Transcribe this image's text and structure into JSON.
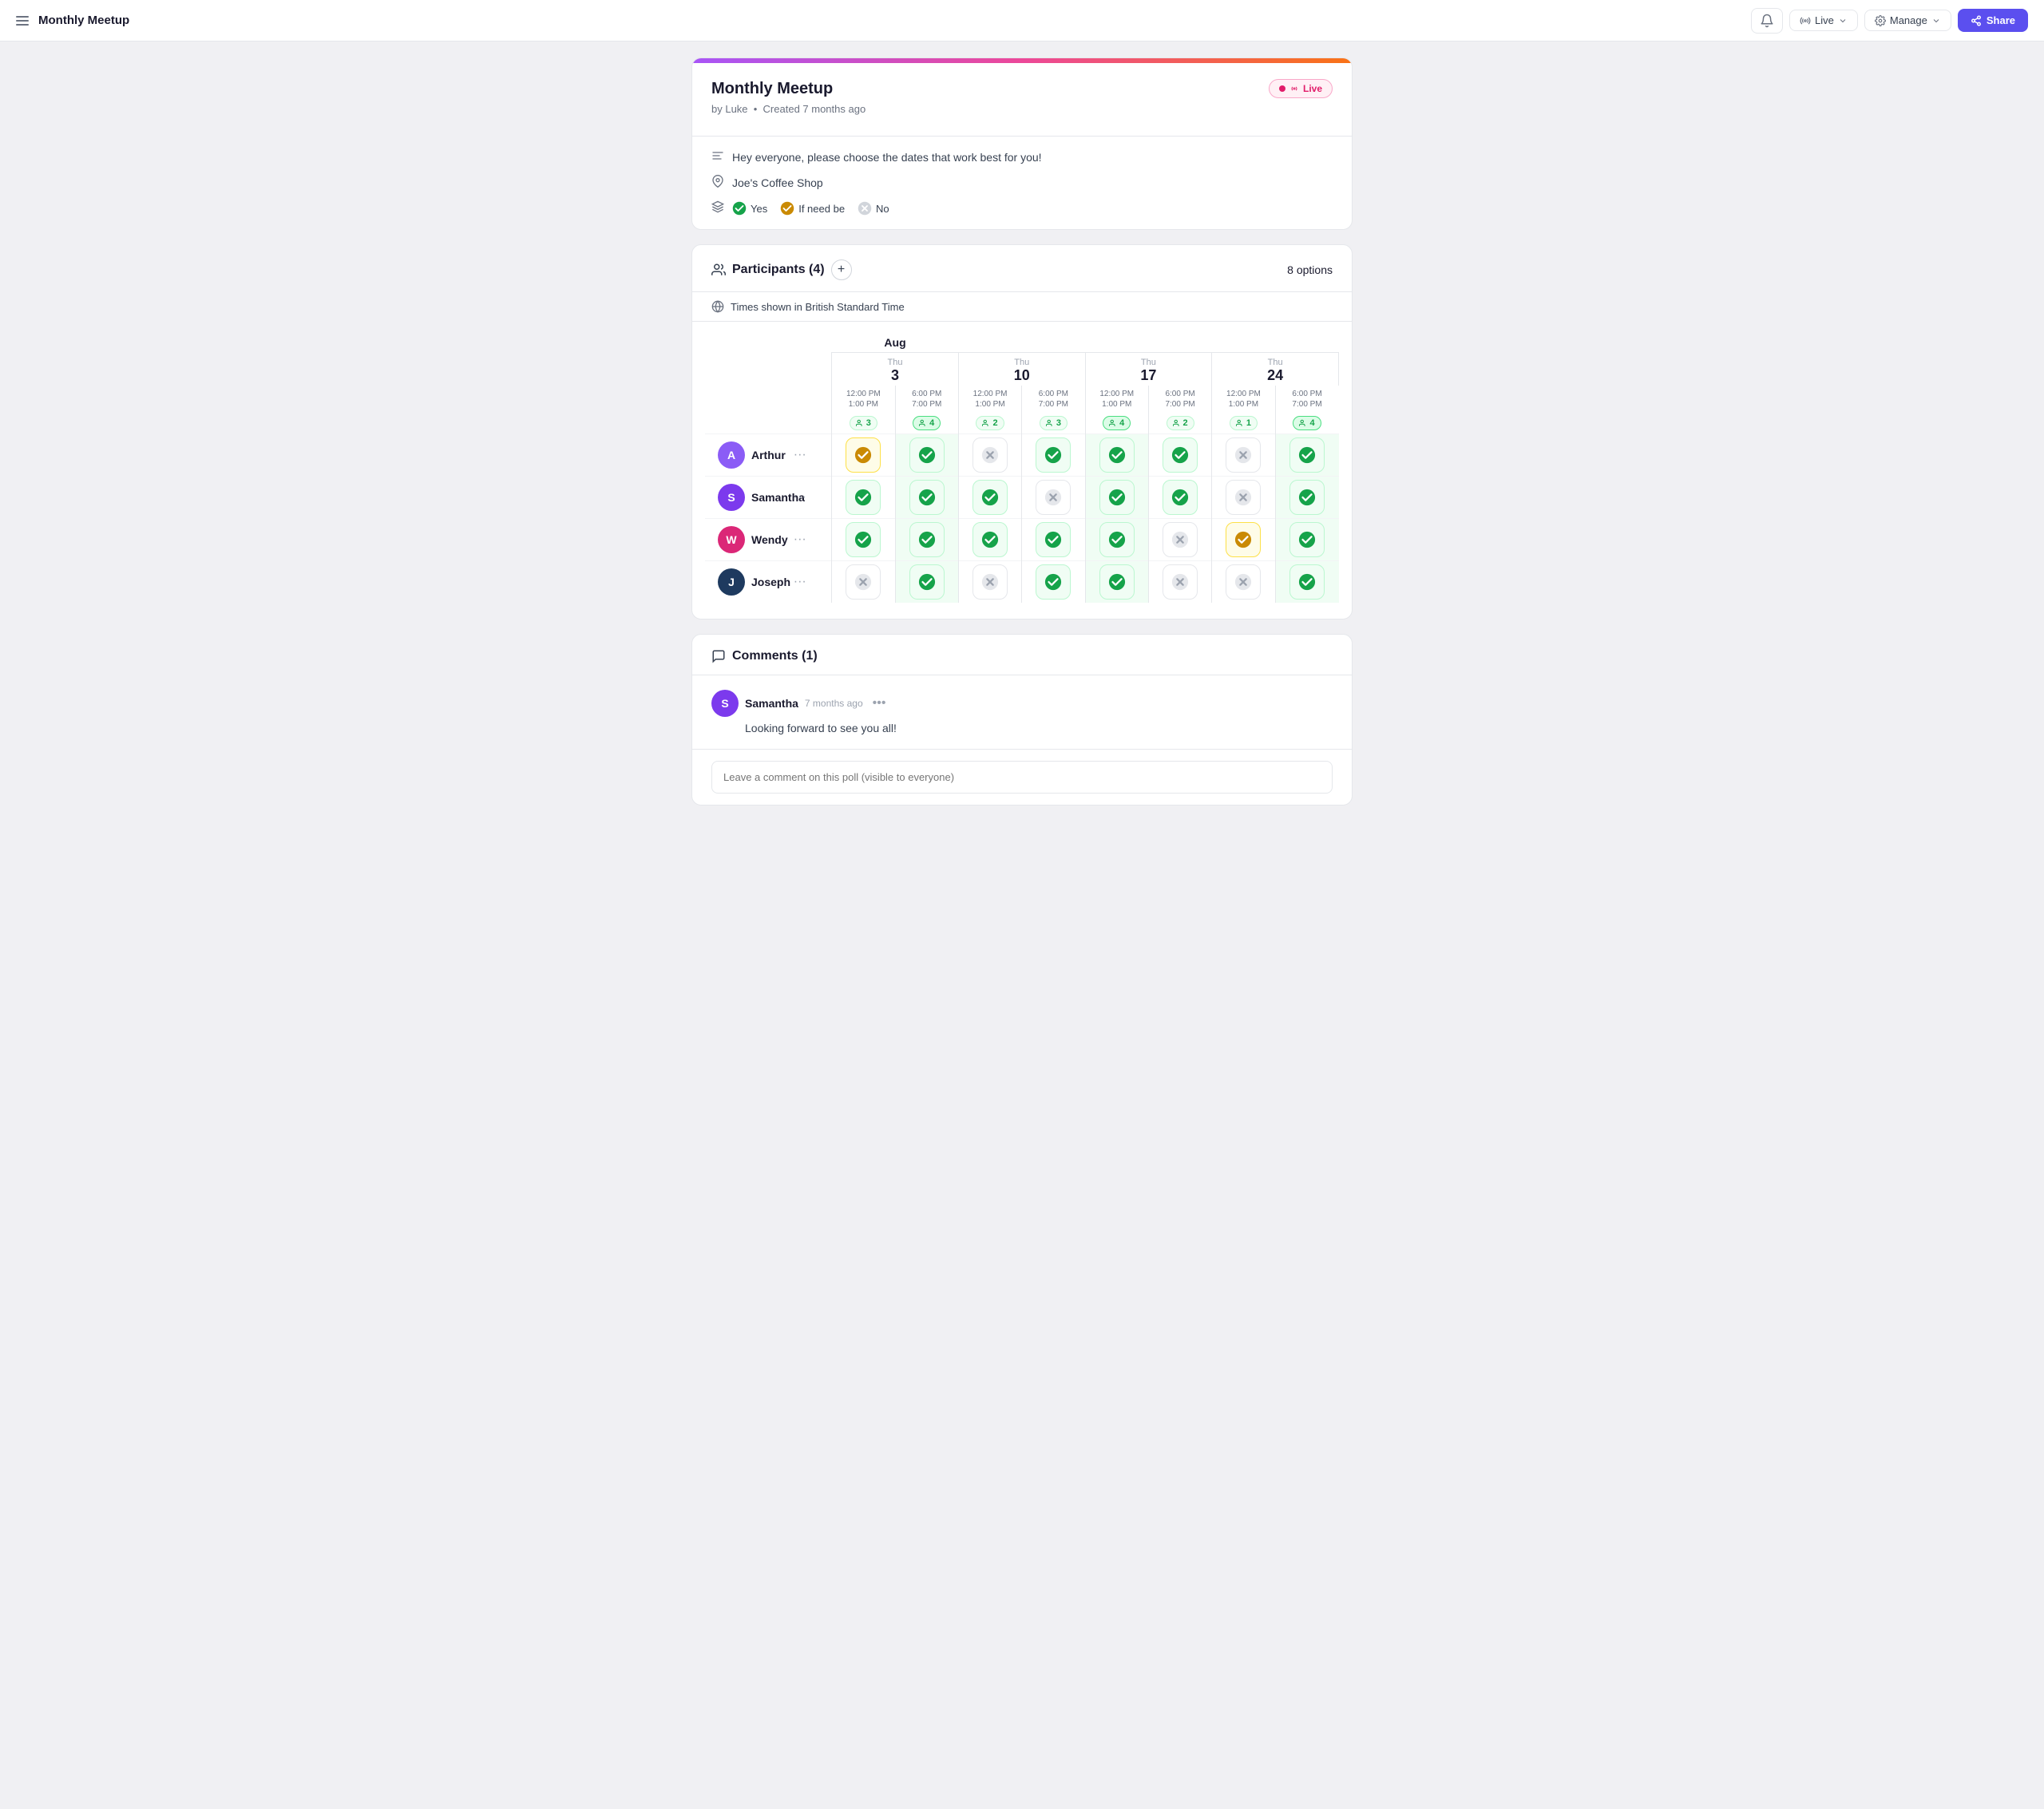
{
  "nav": {
    "menu_icon": "☰",
    "title": "Monthly Meetup",
    "bell_label": "notifications",
    "live_label": "Live",
    "manage_label": "Manage",
    "share_label": "Share"
  },
  "poll": {
    "title": "Monthly Meetup",
    "by": "by Luke",
    "created": "Created 7 months ago",
    "live_badge": "Live",
    "description": "Hey everyone, please choose the dates that work best for you!",
    "location": "Joe's Coffee Shop",
    "legend": {
      "yes": "Yes",
      "if_need_be": "If need be",
      "no": "No"
    }
  },
  "participants": {
    "section_title": "Participants (4)",
    "add_label": "+",
    "options_count": "8 options",
    "timezone": "Times shown in British Standard Time",
    "month": "Aug",
    "days": [
      {
        "name": "Thu",
        "num": "3"
      },
      {
        "name": "Thu",
        "num": "3"
      },
      {
        "name": "Thu",
        "num": "10"
      },
      {
        "name": "Thu",
        "num": "10"
      },
      {
        "name": "Thu",
        "num": "17"
      },
      {
        "name": "Thu",
        "num": "17"
      },
      {
        "name": "Thu",
        "num": "24"
      },
      {
        "name": "Thu",
        "num": "24"
      }
    ],
    "slots": [
      {
        "time1": "12:00 PM",
        "time2": "1:00 PM"
      },
      {
        "time1": "6:00 PM",
        "time2": "7:00 PM"
      },
      {
        "time1": "12:00 PM",
        "time2": "1:00 PM"
      },
      {
        "time1": "6:00 PM",
        "time2": "7:00 PM"
      },
      {
        "time1": "12:00 PM",
        "time2": "1:00 PM"
      },
      {
        "time1": "6:00 PM",
        "time2": "7:00 PM"
      },
      {
        "time1": "12:00 PM",
        "time2": "1:00 PM"
      },
      {
        "time1": "6:00 PM",
        "time2": "7:00 PM"
      }
    ],
    "counts": [
      3,
      4,
      2,
      3,
      4,
      2,
      1,
      4
    ],
    "counts_highlight": [
      false,
      true,
      false,
      false,
      true,
      false,
      false,
      true
    ],
    "people": [
      {
        "name": "Arthur",
        "initial": "A",
        "color": "#8b5cf6",
        "availability": [
          "ifneedbe",
          "yes",
          "x",
          "yes",
          "yes",
          "yes",
          "x",
          "yes"
        ]
      },
      {
        "name": "Samantha",
        "initial": "S",
        "color": "#7c3aed",
        "availability": [
          "yes",
          "yes",
          "yes",
          "x",
          "yes",
          "yes",
          "x",
          "yes"
        ]
      },
      {
        "name": "Wendy",
        "initial": "W",
        "color": "#db2777",
        "availability": [
          "yes",
          "yes",
          "yes",
          "yes",
          "yes",
          "x",
          "ifneedbe",
          "yes"
        ]
      },
      {
        "name": "Joseph",
        "initial": "J",
        "color": "#1e3a5f",
        "availability": [
          "x",
          "yes",
          "x",
          "yes",
          "yes",
          "x",
          "x",
          "yes"
        ]
      }
    ]
  },
  "comments": {
    "section_title": "Comments (1)",
    "comment_author": "Samantha",
    "comment_initial": "S",
    "comment_color": "#7c3aed",
    "comment_time": "7 months ago",
    "comment_text": "Looking forward to see you all!",
    "input_placeholder": "Leave a comment on this poll (visible to everyone)"
  }
}
